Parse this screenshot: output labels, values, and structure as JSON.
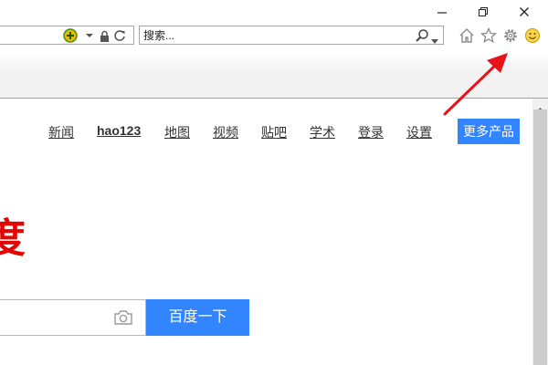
{
  "browser": {
    "window_controls": [
      "minimize",
      "restore",
      "close"
    ],
    "address_bar": {
      "icons": [
        "compat-view-icon",
        "dropdown-icon",
        "lock-icon",
        "refresh-icon"
      ]
    },
    "search_box": {
      "placeholder": "搜索..."
    },
    "toolbar_icons": [
      "home-icon",
      "favorites-star-icon",
      "settings-gear-icon",
      "smiley-feedback-icon"
    ]
  },
  "page": {
    "nav": [
      "新闻",
      "hao123",
      "地图",
      "视频",
      "贴吧",
      "学术",
      "登录",
      "设置"
    ],
    "more_products": "更多产品",
    "logo_text": "度",
    "search_button": "百度一下"
  },
  "colors": {
    "accent_blue": "#3385ff",
    "logo_red": "#e10601",
    "annotation_arrow": "#e8121a"
  }
}
